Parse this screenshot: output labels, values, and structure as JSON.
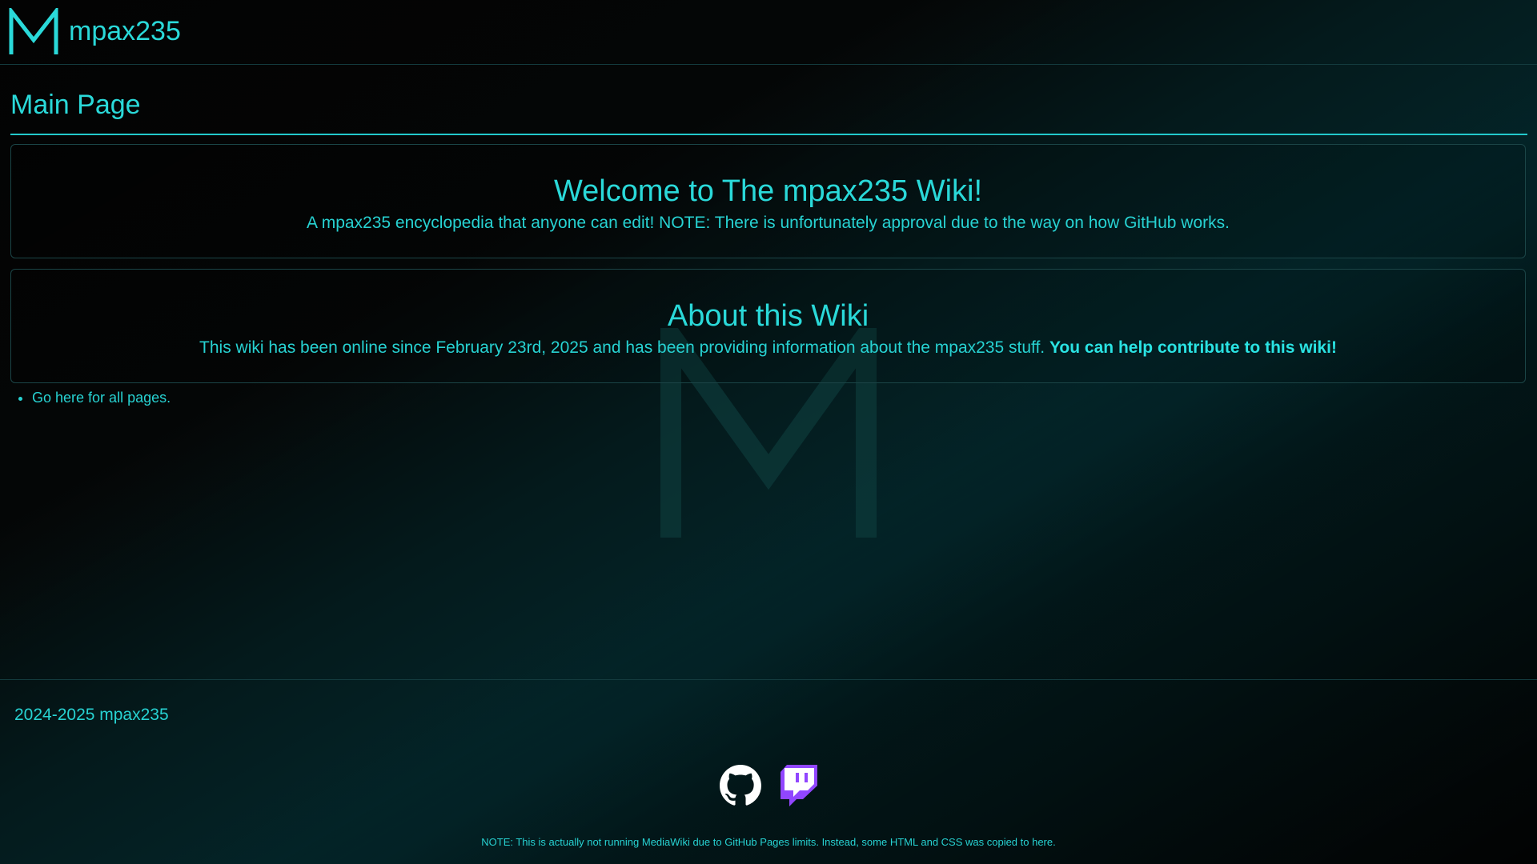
{
  "header": {
    "logo_letter": "M",
    "site_name": "mpax235"
  },
  "page": {
    "title": "Main Page"
  },
  "welcome": {
    "heading": "Welcome to The mpax235 Wiki!",
    "text": "A mpax235 encyclopedia that anyone can edit! NOTE: There is unfortunately approval due to the way on how GitHub works."
  },
  "about": {
    "heading": "About this Wiki",
    "text": "This wiki has been online since February 23rd, 2025 and has been providing information about the mpax235 stuff.",
    "cta": "You can help contribute to this wiki!"
  },
  "links": {
    "all_pages_prefix": "Go ",
    "all_pages_link": "here",
    "all_pages_suffix": " for all pages."
  },
  "footer": {
    "copyright": "2024-2025 mpax235",
    "social": [
      {
        "icon": "github-icon",
        "color": "#ffffff"
      },
      {
        "icon": "twitch-icon",
        "color": "#9146ff"
      }
    ],
    "note": "NOTE: This is actually not running MediaWiki due to GitHub Pages limits. Instead, some HTML and CSS was copied to here."
  },
  "colors": {
    "accent": "#2ad9d9",
    "background": "#050707",
    "twitch": "#9146ff"
  }
}
